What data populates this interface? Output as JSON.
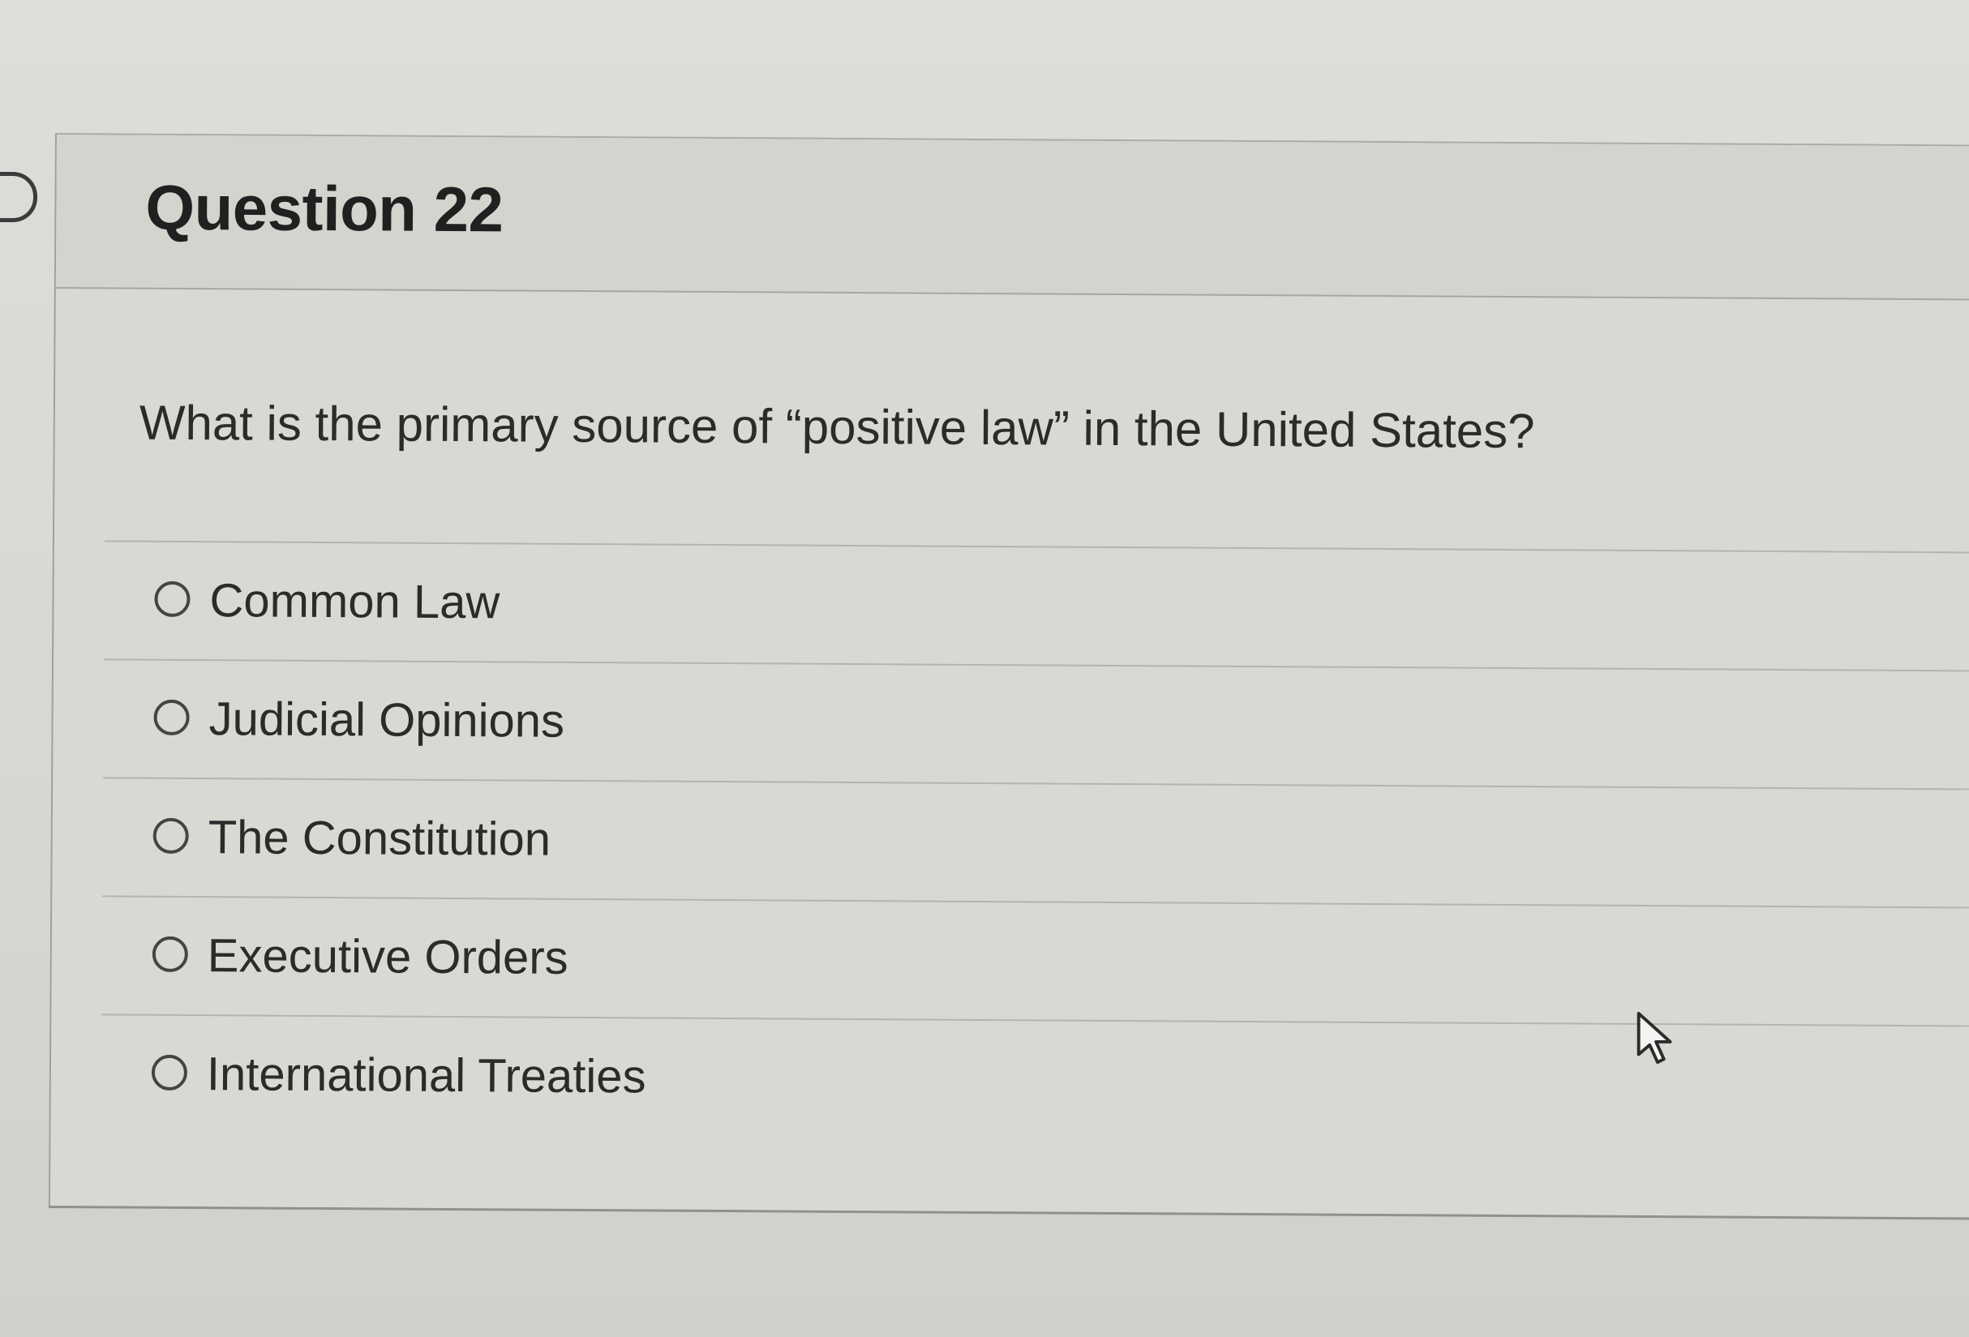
{
  "question": {
    "title": "Question 22",
    "prompt": "What is the primary source of “positive law” in the United States?"
  },
  "answers": [
    {
      "label": "Common Law",
      "selected": false
    },
    {
      "label": "Judicial Opinions",
      "selected": false
    },
    {
      "label": "The Constitution",
      "selected": false
    },
    {
      "label": "Executive Orders",
      "selected": false
    },
    {
      "label": "International Treaties",
      "selected": false
    }
  ],
  "icons": {
    "flag": "flag-question-icon",
    "cursor": "mouse-pointer-icon"
  }
}
